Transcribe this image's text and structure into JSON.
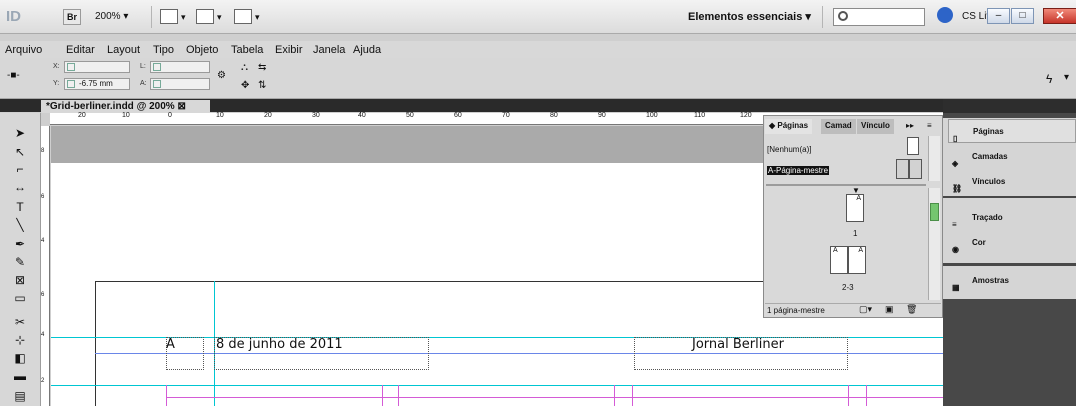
{
  "app": {
    "logo_text": "ID",
    "bridge_label": "Br",
    "zoom": "200%",
    "workspace_label": "Elementos essenciais",
    "cslive_label": "CS Live"
  },
  "menu": {
    "items": [
      "Arquivo",
      "Editar",
      "Layout",
      "Tipo",
      "Objeto",
      "Tabela",
      "Exibir",
      "Janela",
      "Ajuda"
    ]
  },
  "control": {
    "x_label": "X:",
    "y_label": "Y:",
    "y_value": "-6.75 mm",
    "w_label": "L:",
    "h_label": "A:"
  },
  "document": {
    "tab_title": "*Grid-berliner.indd @ 200%"
  },
  "ruler": {
    "h_ticks": [
      "20",
      "10",
      "0",
      "10",
      "20",
      "30",
      "40",
      "50",
      "60",
      "70",
      "80",
      "90",
      "100",
      "110",
      "120"
    ],
    "v_ticks": [
      "8",
      "6",
      "4",
      "6",
      "4",
      "2",
      "0"
    ]
  },
  "page": {
    "master_marker": "A",
    "date_text": "8 de junho de 2011",
    "title_text": "Jornal Berliner"
  },
  "pages_panel": {
    "tabs": [
      "Páginas",
      "Camad",
      "Vínculo"
    ],
    "none_label": "[Nenhum(a)]",
    "master_label": "A-Página-mestre",
    "page1_label": "1",
    "page1_letter": "A",
    "spread_label": "2-3",
    "spread_left_letter": "A",
    "spread_right_letter": "A",
    "footer": "1 página-mestre"
  },
  "dock": {
    "items": [
      "Páginas",
      "Camadas",
      "Vínculos",
      "Traçado",
      "Cor",
      "Amostras"
    ]
  }
}
